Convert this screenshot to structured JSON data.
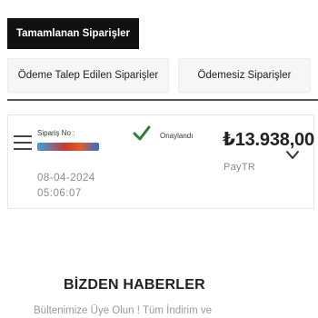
{
  "tabs": {
    "completed_orders": "Tamamlanan Siparişler"
  },
  "filters": {
    "payment_requested": "Ödeme Talep Edilen Siparişler",
    "unpaid": "Ödemesiz Siparişler"
  },
  "order": {
    "order_no_label": "Sipariş No :",
    "status": "Onaylandı",
    "amount": "₺13.938,00",
    "provider": "PayTR",
    "date": "08-04-2024",
    "time": "05:06:07",
    "status_color": "#2e7d32"
  },
  "newsletter": {
    "title": "BİZDEN HABERLER",
    "text": "Bültenimize Üye Olun ! Tüm İndirim ve"
  },
  "icons": {
    "menu": "menu-icon",
    "status": "check-icon",
    "expand": "chevron-down-icon"
  }
}
